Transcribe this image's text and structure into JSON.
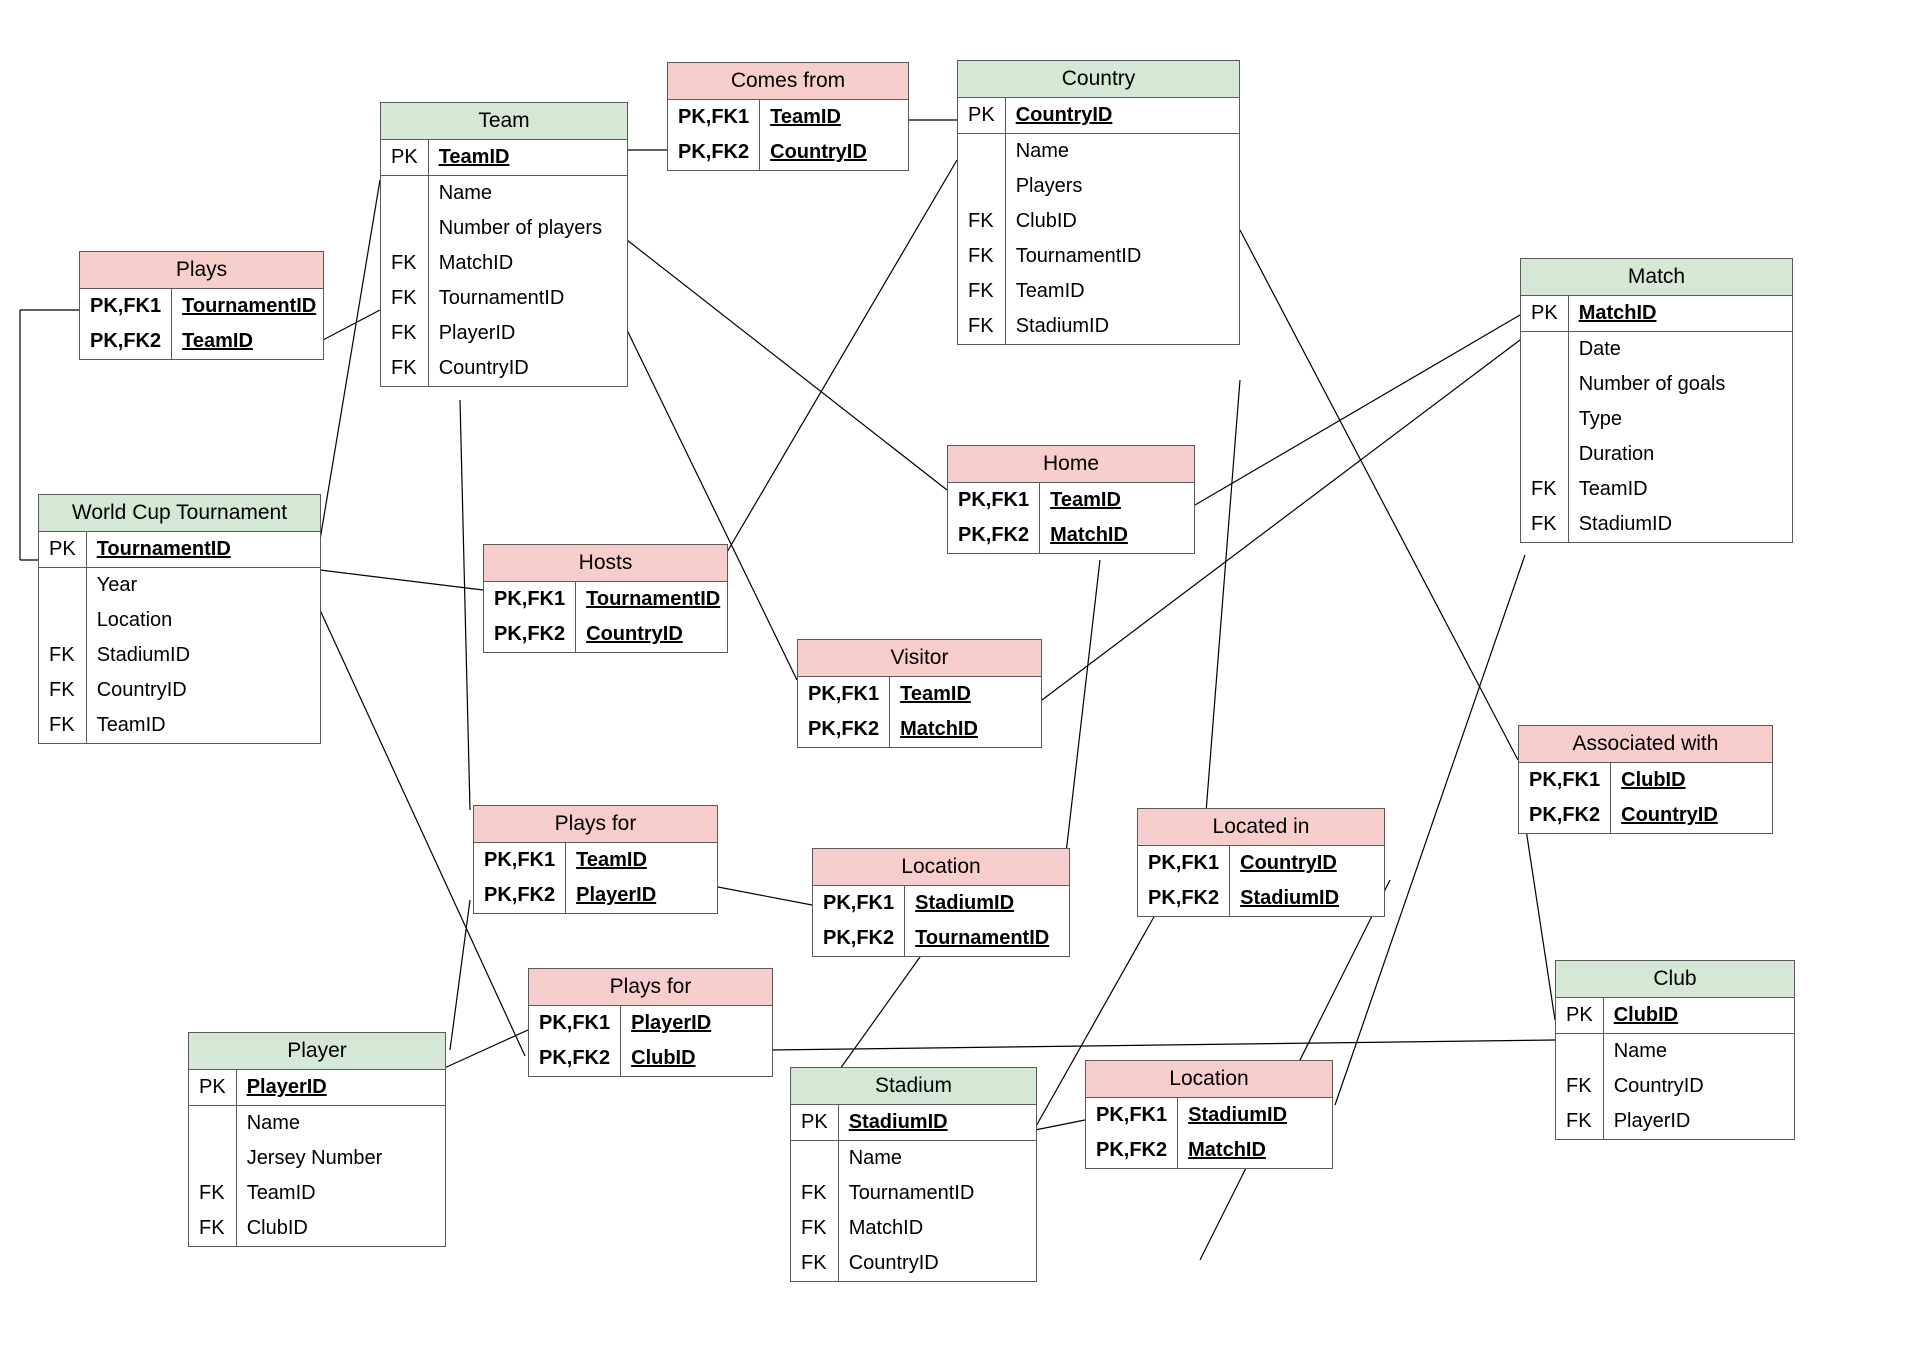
{
  "colors": {
    "green": "#d4e8d4",
    "pink": "#f8cecc"
  },
  "entities": {
    "plays": {
      "title": "Plays",
      "rows": [
        {
          "key": "PK,FK1",
          "attr": "TournamentID"
        },
        {
          "key": "PK,FK2",
          "attr": "TeamID"
        }
      ]
    },
    "team": {
      "title": "Team",
      "rows": [
        {
          "key": "PK",
          "attr": "TeamID"
        },
        {
          "key": "",
          "attr": "Name"
        },
        {
          "key": "",
          "attr": "Number of players"
        },
        {
          "key": "FK",
          "attr": "MatchID"
        },
        {
          "key": "FK",
          "attr": "TournamentID"
        },
        {
          "key": "FK",
          "attr": "PlayerID"
        },
        {
          "key": "FK",
          "attr": "CountryID"
        }
      ]
    },
    "comesfrom": {
      "title": "Comes from",
      "rows": [
        {
          "key": "PK,FK1",
          "attr": "TeamID"
        },
        {
          "key": "PK,FK2",
          "attr": "CountryID"
        }
      ]
    },
    "country": {
      "title": "Country",
      "rows": [
        {
          "key": "PK",
          "attr": "CountryID"
        },
        {
          "key": "",
          "attr": "Name"
        },
        {
          "key": "",
          "attr": "Players"
        },
        {
          "key": "FK",
          "attr": "ClubID"
        },
        {
          "key": "FK",
          "attr": "TournamentID"
        },
        {
          "key": "FK",
          "attr": "TeamID"
        },
        {
          "key": "FK",
          "attr": "StadiumID"
        }
      ]
    },
    "match": {
      "title": "Match",
      "rows": [
        {
          "key": "PK",
          "attr": "MatchID"
        },
        {
          "key": "",
          "attr": "Date"
        },
        {
          "key": "",
          "attr": "Number of goals"
        },
        {
          "key": "",
          "attr": "Type"
        },
        {
          "key": "",
          "attr": "Duration"
        },
        {
          "key": "FK",
          "attr": "TeamID"
        },
        {
          "key": "FK",
          "attr": "StadiumID"
        }
      ]
    },
    "wct": {
      "title": "World Cup Tournament",
      "rows": [
        {
          "key": "PK",
          "attr": "TournamentID"
        },
        {
          "key": "",
          "attr": "Year"
        },
        {
          "key": "",
          "attr": "Location"
        },
        {
          "key": "FK",
          "attr": "StadiumID"
        },
        {
          "key": "FK",
          "attr": "CountryID"
        },
        {
          "key": "FK",
          "attr": "TeamID"
        }
      ]
    },
    "hosts": {
      "title": "Hosts",
      "rows": [
        {
          "key": "PK,FK1",
          "attr": "TournamentID"
        },
        {
          "key": "PK,FK2",
          "attr": "CountryID"
        }
      ]
    },
    "home": {
      "title": "Home",
      "rows": [
        {
          "key": "PK,FK1",
          "attr": "TeamID"
        },
        {
          "key": "PK,FK2",
          "attr": "MatchID"
        }
      ]
    },
    "visitor": {
      "title": "Visitor",
      "rows": [
        {
          "key": "PK,FK1",
          "attr": "TeamID"
        },
        {
          "key": "PK,FK2",
          "attr": "MatchID"
        }
      ]
    },
    "associated": {
      "title": "Associated with",
      "rows": [
        {
          "key": "PK,FK1",
          "attr": "ClubID"
        },
        {
          "key": "PK,FK2",
          "attr": "CountryID"
        }
      ]
    },
    "playsforTeam": {
      "title": "Plays for",
      "rows": [
        {
          "key": "PK,FK1",
          "attr": "TeamID"
        },
        {
          "key": "PK,FK2",
          "attr": "PlayerID"
        }
      ]
    },
    "playsforClub": {
      "title": "Plays for",
      "rows": [
        {
          "key": "PK,FK1",
          "attr": "PlayerID"
        },
        {
          "key": "PK,FK2",
          "attr": "ClubID"
        }
      ]
    },
    "locationTourn": {
      "title": "Location",
      "rows": [
        {
          "key": "PK,FK1",
          "attr": "StadiumID"
        },
        {
          "key": "PK,FK2",
          "attr": "TournamentID"
        }
      ]
    },
    "locatedin": {
      "title": "Located in",
      "rows": [
        {
          "key": "PK,FK1",
          "attr": "CountryID"
        },
        {
          "key": "PK,FK2",
          "attr": "StadiumID"
        }
      ]
    },
    "locationMatch": {
      "title": "Location",
      "rows": [
        {
          "key": "PK,FK1",
          "attr": "StadiumID"
        },
        {
          "key": "PK,FK2",
          "attr": "MatchID"
        }
      ]
    },
    "club": {
      "title": "Club",
      "rows": [
        {
          "key": "PK",
          "attr": "ClubID"
        },
        {
          "key": "",
          "attr": "Name"
        },
        {
          "key": "FK",
          "attr": "CountryID"
        },
        {
          "key": "FK",
          "attr": "PlayerID"
        }
      ]
    },
    "player": {
      "title": "Player",
      "rows": [
        {
          "key": "PK",
          "attr": "PlayerID"
        },
        {
          "key": "",
          "attr": "Name"
        },
        {
          "key": "",
          "attr": "Jersey Number"
        },
        {
          "key": "FK",
          "attr": "TeamID"
        },
        {
          "key": "FK",
          "attr": "ClubID"
        }
      ]
    },
    "stadium": {
      "title": "Stadium",
      "rows": [
        {
          "key": "PK",
          "attr": "StadiumID"
        },
        {
          "key": "",
          "attr": "Name"
        },
        {
          "key": "FK",
          "attr": "TournamentID"
        },
        {
          "key": "FK",
          "attr": "MatchID"
        },
        {
          "key": "FK",
          "attr": "CountryID"
        }
      ]
    }
  }
}
